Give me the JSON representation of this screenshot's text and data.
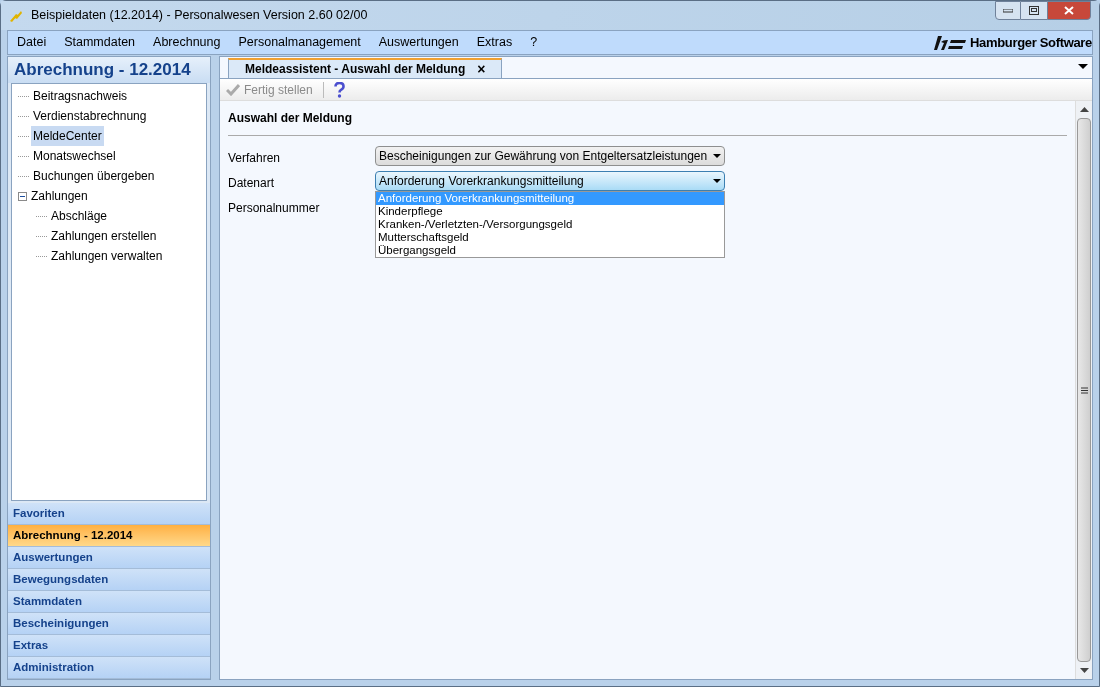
{
  "window": {
    "title": "Beispieldaten (12.2014) - Personalwesen Version 2.60 02/00"
  },
  "menu": [
    "Datei",
    "Stammdaten",
    "Abrechnung",
    "Personalmanagement",
    "Auswertungen",
    "Extras",
    "?"
  ],
  "logo": {
    "text": "Hamburger Software"
  },
  "sidebar": {
    "title": "Abrechnung - 12.2014",
    "tree": [
      {
        "label": "Beitragsnachweis",
        "selected": false
      },
      {
        "label": "Verdienstabrechnung",
        "selected": false
      },
      {
        "label": "MeldeCenter",
        "selected": true
      },
      {
        "label": "Monatswechsel",
        "selected": false
      },
      {
        "label": "Buchungen übergeben",
        "selected": false
      },
      {
        "label": "Zahlungen",
        "selected": false,
        "expanded": true,
        "children": [
          {
            "label": "Abschläge",
            "selected": false
          },
          {
            "label": "Zahlungen erstellen",
            "selected": false
          },
          {
            "label": "Zahlungen verwalten",
            "selected": false
          }
        ]
      }
    ],
    "nav": [
      {
        "label": "Favoriten",
        "selected": false
      },
      {
        "label": "Abrechnung - 12.2014",
        "selected": true
      },
      {
        "label": "Auswertungen",
        "selected": false
      },
      {
        "label": "Bewegungsdaten",
        "selected": false
      },
      {
        "label": "Stammdaten",
        "selected": false
      },
      {
        "label": "Bescheinigungen",
        "selected": false
      },
      {
        "label": "Extras",
        "selected": false
      },
      {
        "label": "Administration",
        "selected": false
      }
    ]
  },
  "tab": {
    "label": "Meldeassistent - Auswahl der Meldung",
    "close": "×"
  },
  "toolbar": [
    {
      "label": "Fertig stellen",
      "disabled": true
    }
  ],
  "form": {
    "title": "Auswahl der Meldung",
    "fields": [
      {
        "label": "Verfahren",
        "kind": "dropdown",
        "value": "Bescheinigungen zur Gewährung von Entgeltersatzleistungen",
        "focused": false
      },
      {
        "label": "Datenart",
        "kind": "dropdown",
        "value": "Anforderung Vorerkrankungsmitteilung",
        "focused": true,
        "options": [
          {
            "label": "Anforderung Vorerkrankungsmitteilung",
            "selected": true
          },
          {
            "label": "Kinderpflege",
            "selected": false
          },
          {
            "label": "Kranken-/Verletzten-/Versorgungsgeld",
            "selected": false
          },
          {
            "label": "Mutterschaftsgeld",
            "selected": false
          },
          {
            "label": "Übergangsgeld",
            "selected": false
          }
        ]
      },
      {
        "label": "Personalnummer",
        "kind": "text"
      }
    ]
  }
}
